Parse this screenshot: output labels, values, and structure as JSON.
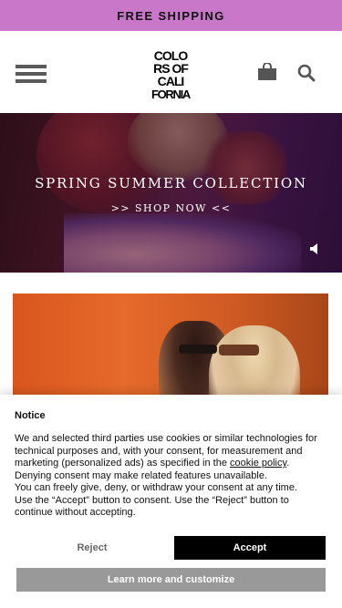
{
  "promo_bar": {
    "text": "FREE SHIPPING"
  },
  "header": {
    "menu_icon": "hamburger-menu-icon",
    "logo_lines": [
      "COLO",
      "RS OF",
      "CALI",
      "FORNIA"
    ],
    "cart_icon": "shopping-bag-icon",
    "search_icon": "search-icon"
  },
  "hero": {
    "title": "SPRING SUMMER COLLECTION",
    "link": ">> SHOP NOW <<",
    "sound_icon": "speaker-icon"
  },
  "cookie_notice": {
    "title": "Notice",
    "text_before_link": "We and selected third parties use cookies or similar technologies for technical purposes and, with your consent, for measurement and marketing (personalized ads) as specified in the ",
    "link_text": "cookie policy",
    "text_after_link": ". Denying consent may make related features unavailable.",
    "line2": "You can freely give, deny, or withdraw your consent at any time.",
    "line3": "Use the “Accept” button to consent. Use the “Reject” button to continue without accepting.",
    "reject_label": "Reject",
    "accept_label": "Accept",
    "learn_more_label": "Learn more and customize"
  },
  "colors": {
    "promo_bg": "#c877c9",
    "accept_bg": "#000000",
    "learn_more_bg": "#999999"
  }
}
